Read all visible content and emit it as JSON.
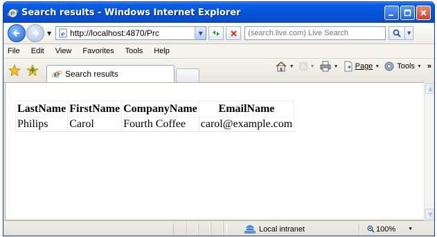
{
  "window": {
    "title": "Search results - Windows Internet Explorer"
  },
  "address_bar": {
    "url": "http://localhost:4870/Prc"
  },
  "search_box": {
    "placeholder": "(search.live.com) Live Search"
  },
  "menu": {
    "items": [
      "File",
      "Edit",
      "View",
      "Favorites",
      "Tools",
      "Help"
    ]
  },
  "tabs": [
    {
      "label": "Search results",
      "active": true
    }
  ],
  "command_bar": {
    "page_label": "Page",
    "tools_label": "Tools",
    "more_label": "»"
  },
  "results_table": {
    "headers": [
      "LastName",
      "FirstName",
      "CompanyName",
      "EmailName"
    ],
    "rows": [
      [
        "Philips",
        "Carol",
        "Fourth Coffee",
        "carol@example.com"
      ]
    ]
  },
  "status_bar": {
    "zone": "Local intranet",
    "zoom": "100%"
  },
  "colors": {
    "titlebar": "#0453d6",
    "chrome": "#ece9d8"
  }
}
